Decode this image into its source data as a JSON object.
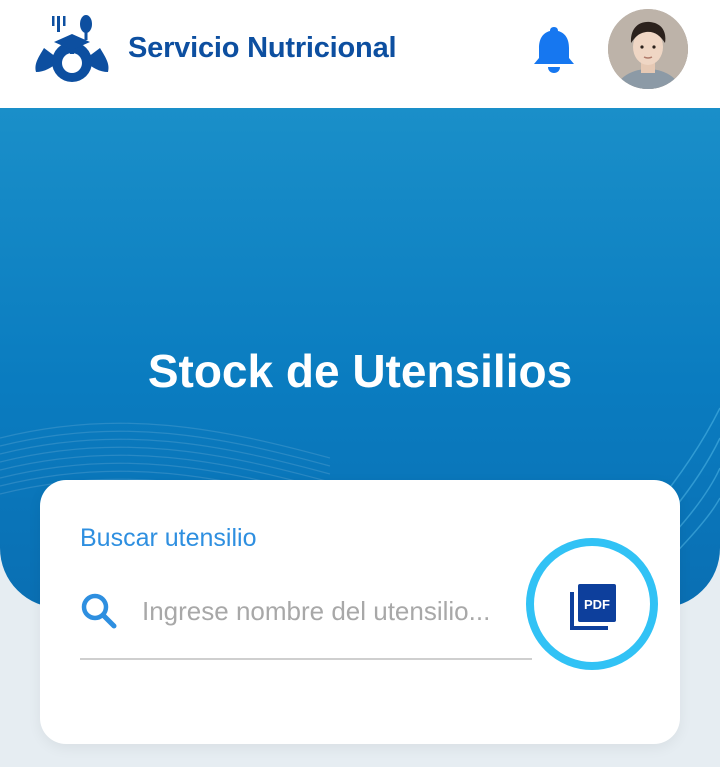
{
  "header": {
    "app_title": "Servicio Nutricional",
    "logo_icon": "fork-spoon-graduation-cap-logo",
    "notification_icon": "bell-icon",
    "avatar_icon": "user-avatar"
  },
  "hero": {
    "title": "Stock de Utensilios"
  },
  "search": {
    "label": "Buscar utensilio",
    "placeholder": "Ingrese nombre del utensilio...",
    "value": "",
    "search_icon": "search-icon",
    "pdf_icon": "pdf-icon",
    "pdf_text": "PDF"
  },
  "colors": {
    "brand_dark": "#0d4fa0",
    "hero_blue": "#0a7cc0",
    "accent_blue": "#2e8fe0",
    "highlight_ring": "#31c2f5",
    "bell_blue": "#1677f0"
  }
}
